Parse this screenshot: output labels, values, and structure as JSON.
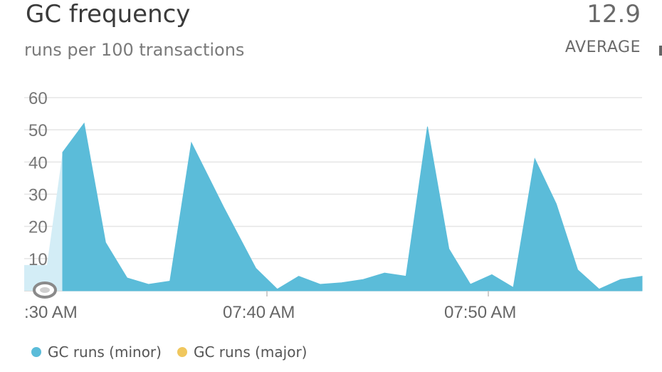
{
  "header": {
    "title": "GC frequency",
    "subtitle": "runs per 100 transactions",
    "value": "12.9",
    "value_label": "AVERAGE"
  },
  "colors": {
    "minor": "#5bbcd9",
    "minor_bg": "#d3edf6",
    "major": "#f0c75e",
    "grid": "#e5e5e5"
  },
  "chart_data": {
    "type": "area",
    "title": "",
    "ylim": [
      0,
      60
    ],
    "yticks": [
      60,
      50,
      40,
      30,
      20,
      10
    ],
    "xtick_labels": [
      ":30 AM",
      "07:40 AM",
      "07:50 AM"
    ],
    "grid": true,
    "legend_position": "bottom-left",
    "x_minutes": [
      7.0,
      8.0,
      9.0,
      10.0,
      11.0,
      12.0,
      13.0,
      14.0,
      15.0,
      17.0,
      19.0,
      21.0,
      22.0,
      23.0,
      24.0,
      25.0,
      26.0,
      27.0,
      28.0,
      29.0,
      30.0,
      31.0,
      32.0,
      33.0,
      34.0,
      35.0,
      36.0,
      37.0,
      38.0,
      39.0,
      40.0,
      41.0,
      42.0,
      43.0,
      44.0,
      45.0,
      46.0,
      47.0,
      48.0
    ],
    "series": [
      {
        "name": "GC runs (minor)",
        "color": "#5bbcd9",
        "values": [
          43,
          52,
          15,
          4,
          2,
          3,
          46,
          26,
          7,
          5,
          2,
          3,
          3.5,
          5.5,
          4.5,
          51,
          13,
          2.5,
          5,
          1,
          41,
          27,
          6.5,
          1,
          3.5,
          4.5,
          0,
          0,
          0,
          0,
          0,
          0,
          0,
          0,
          0,
          0,
          0,
          0,
          0
        ]
      },
      {
        "name": "GC runs (major)",
        "color": "#f0c75e",
        "values": []
      }
    ],
    "series_x": [
      7,
      8,
      9,
      10,
      11,
      12,
      13,
      14.5,
      16,
      17,
      18,
      19,
      20,
      21,
      22,
      23,
      24,
      25,
      26,
      27,
      28,
      29,
      30,
      31,
      32,
      33,
      34
    ],
    "series_values": [
      43,
      52,
      15,
      4,
      2,
      3,
      46,
      26,
      7,
      0.5,
      4.5,
      2,
      2.5,
      3.5,
      5.5,
      4.5,
      51,
      13,
      2,
      5,
      1,
      41,
      27,
      6.5,
      0.5,
      3.5,
      4.5
    ]
  },
  "legend": {
    "minor_label": "GC runs (minor)",
    "major_label": "GC runs (major)"
  }
}
